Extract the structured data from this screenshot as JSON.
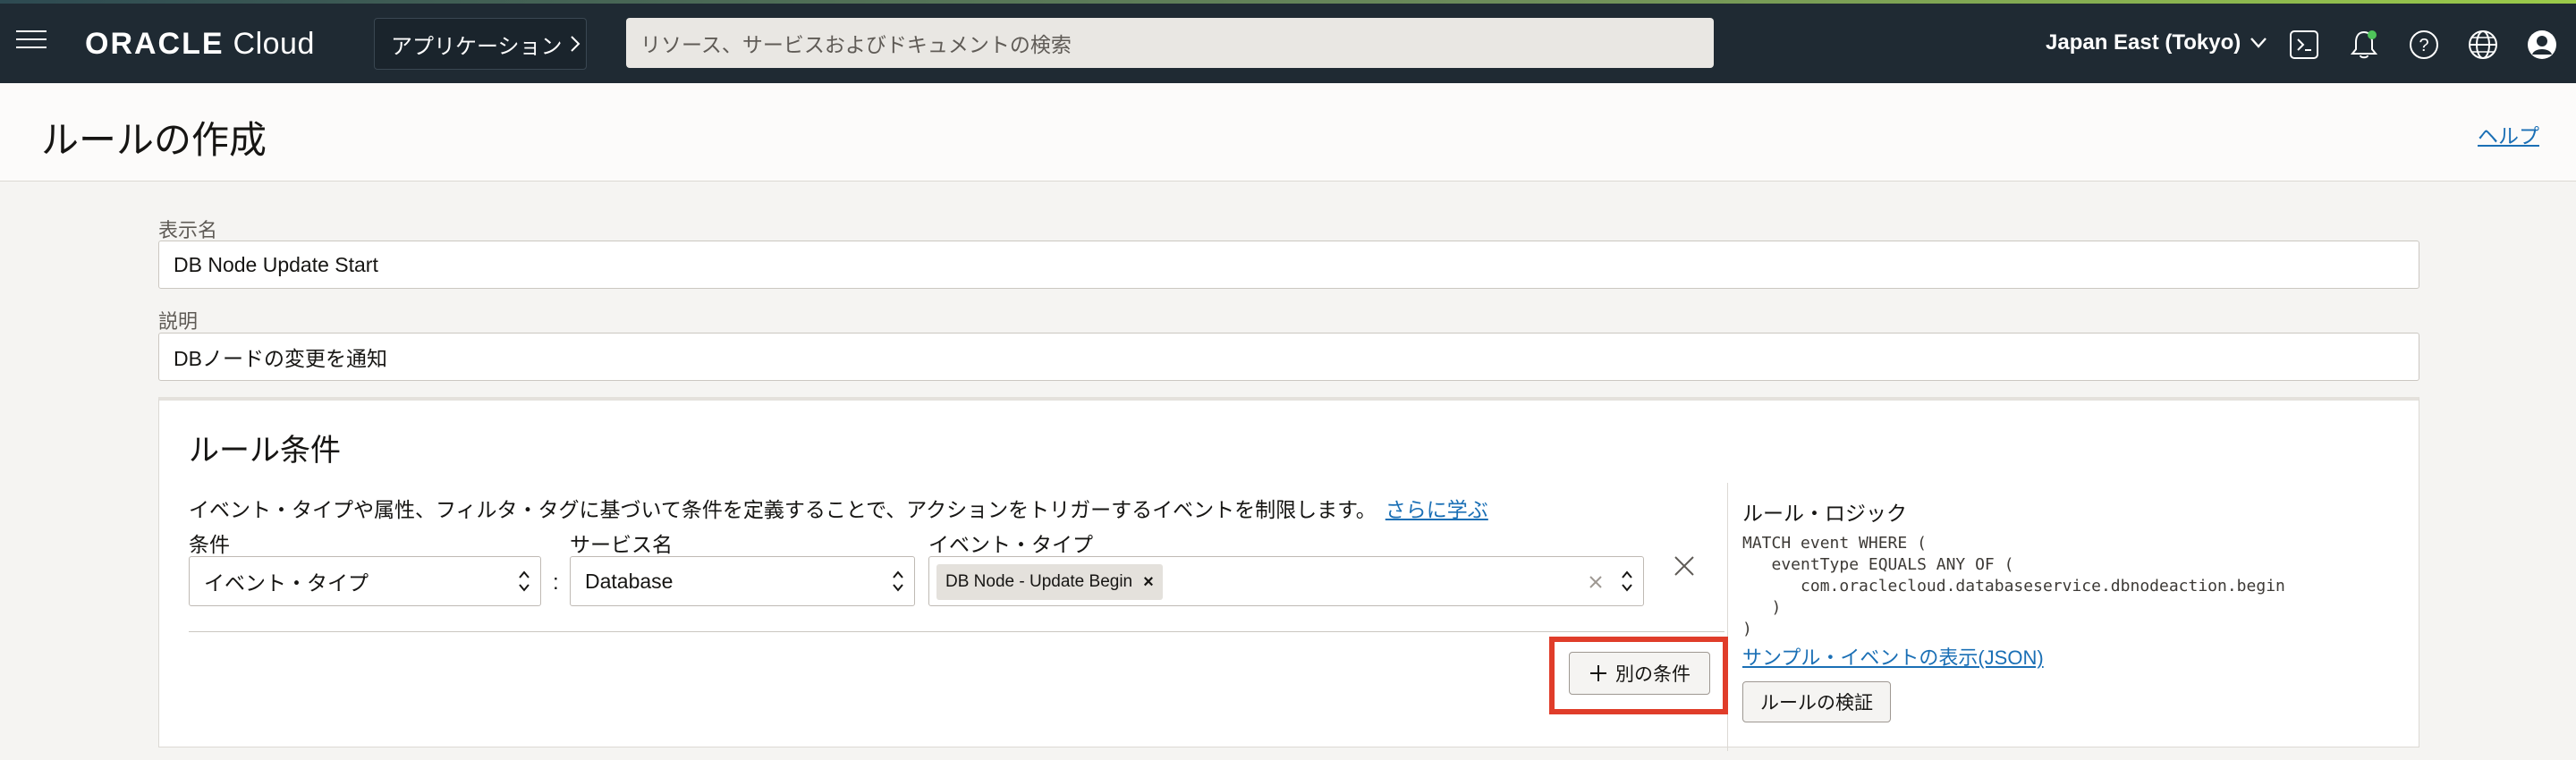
{
  "topbar": {
    "logo_brand": "ORACLE",
    "logo_product": "Cloud",
    "app_menu_label": "アプリケーション",
    "search_placeholder": "リソース、サービスおよびドキュメントの検索",
    "region": "Japan East (Tokyo)"
  },
  "page": {
    "title": "ルールの作成",
    "help_link": "ヘルプ"
  },
  "form": {
    "display_name_label": "表示名",
    "display_name_value": "DB Node Update Start",
    "description_label": "説明",
    "description_value": "DBノードの変更を通知"
  },
  "rule_conditions": {
    "title": "ルール条件",
    "description": "イベント・タイプや属性、フィルタ・タグに基づいて条件を定義することで、アクションをトリガーするイベントを制限します。",
    "learn_more": "さらに学ぶ",
    "condition_label": "条件",
    "condition_value": "イベント・タイプ",
    "service_label": "サービス名",
    "service_value": "Database",
    "event_type_label": "イベント・タイプ",
    "event_type_chip": "DB Node - Update Begin",
    "separator": ":",
    "add_condition_label": "別の条件"
  },
  "rule_logic": {
    "title": "ルール・ロジック",
    "code": "MATCH event WHERE (\n   eventType EQUALS ANY OF (\n      com.oraclecloud.databaseservice.dbnodeaction.begin\n   )\n)",
    "sample_link": "サンプル・イベントの表示(JSON)",
    "verify_label": "ルールの検証"
  },
  "colors": {
    "topbar_bg": "#1f2a33",
    "link": "#1a6fb5",
    "highlight": "#e03d2a"
  },
  "icons": [
    "menu-icon",
    "chevron-right-icon",
    "chevron-down-icon",
    "cloud-shell-icon",
    "bell-icon",
    "help-icon",
    "globe-icon",
    "user-icon",
    "updown-icon",
    "close-icon",
    "plus-icon"
  ]
}
